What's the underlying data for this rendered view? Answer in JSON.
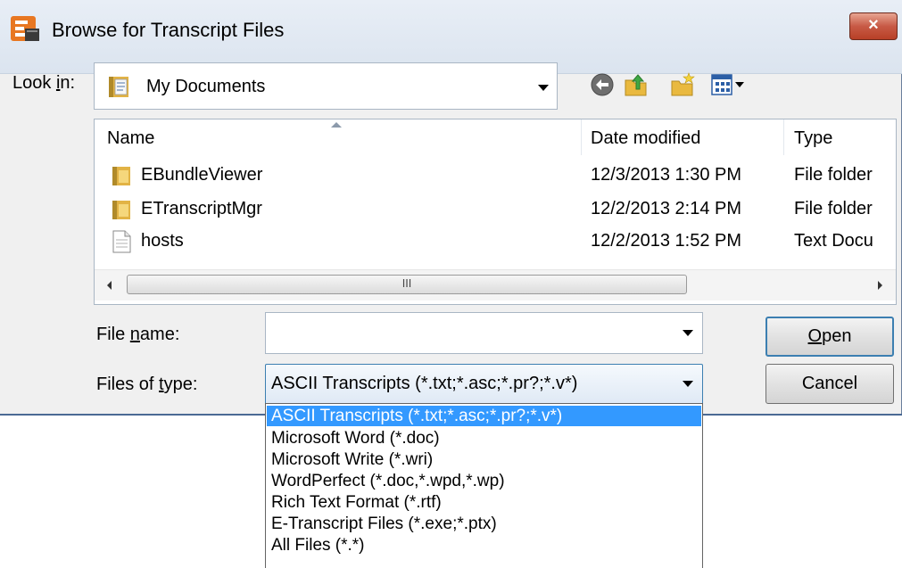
{
  "window": {
    "title": "Browse for Transcript Files",
    "close_label": "×"
  },
  "lookin": {
    "label_prefix": "Look ",
    "label_hotkey": "i",
    "label_suffix": "n:",
    "value": "My Documents"
  },
  "toolbar": {
    "icons": [
      "back-icon",
      "up-folder-icon",
      "new-folder-icon",
      "view-menu-icon"
    ]
  },
  "filelist": {
    "columns": [
      "Name",
      "Date modified",
      "Type"
    ],
    "rows": [
      {
        "name": "EBundleViewer",
        "date": "12/3/2013 1:30 PM",
        "type": "File folder",
        "icon": "folder-icon"
      },
      {
        "name": "ETranscriptMgr",
        "date": "12/2/2013 2:14 PM",
        "type": "File folder",
        "icon": "folder-icon"
      },
      {
        "name": "hosts",
        "date": "12/2/2013 1:52 PM",
        "type": "Text Docu",
        "icon": "text-file-icon"
      }
    ],
    "scroll_grip": "III"
  },
  "filename": {
    "label_prefix": "File ",
    "label_hotkey": "n",
    "label_suffix": "ame:",
    "value": ""
  },
  "filetype": {
    "label_prefix": "Files of ",
    "label_hotkey": "t",
    "label_suffix": "ype:",
    "value": "ASCII Transcripts (*.txt;*.asc;*.pr?;*.v*)",
    "options": [
      "ASCII Transcripts (*.txt;*.asc;*.pr?;*.v*)",
      "Microsoft Word (*.doc)",
      "Microsoft Write (*.wri)",
      "WordPerfect (*.doc,*.wpd,*.wp)",
      "Rich Text Format (*.rtf)",
      "E-Transcript Files (*.exe;*.ptx)",
      "All Files (*.*)"
    ]
  },
  "buttons": {
    "open_hotkey": "O",
    "open_rest": "pen",
    "cancel": "Cancel"
  },
  "colors": {
    "selection": "#3399ff",
    "close_button": "#c75a45",
    "focus_border": "#3c7fb1"
  }
}
